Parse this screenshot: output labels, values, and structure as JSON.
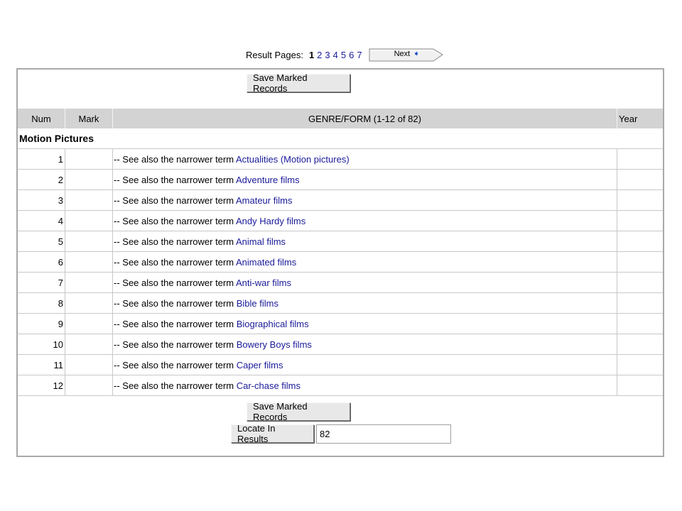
{
  "pager": {
    "label": "Result Pages:",
    "pages": [
      "1",
      "2",
      "3",
      "4",
      "5",
      "6",
      "7"
    ],
    "current": "1",
    "next_label": "Next",
    "next_arrow": "➧"
  },
  "buttons": {
    "save_marked": "Save Marked Records",
    "locate": "Locate In Results"
  },
  "locate_value": "82",
  "table": {
    "headers": {
      "num": "Num",
      "mark": "Mark",
      "genre": "GENRE/FORM (1-12 of 82)",
      "year": "Year"
    },
    "section": "Motion Pictures",
    "prefix": "-- See also the narrower term",
    "rows": [
      {
        "num": "1",
        "term": "Actualities (Motion pictures)"
      },
      {
        "num": "2",
        "term": "Adventure films"
      },
      {
        "num": "3",
        "term": "Amateur films"
      },
      {
        "num": "4",
        "term": "Andy Hardy films"
      },
      {
        "num": "5",
        "term": "Animal films"
      },
      {
        "num": "6",
        "term": "Animated films"
      },
      {
        "num": "7",
        "term": "Anti-war films"
      },
      {
        "num": "8",
        "term": "Bible films"
      },
      {
        "num": "9",
        "term": "Biographical films"
      },
      {
        "num": "10",
        "term": "Bowery Boys films"
      },
      {
        "num": "11",
        "term": "Caper films"
      },
      {
        "num": "12",
        "term": "Car-chase films"
      }
    ]
  },
  "colors": {
    "link": "#1a1a9a",
    "header_bg": "#d3d3d3",
    "border": "#a9a9a9"
  }
}
